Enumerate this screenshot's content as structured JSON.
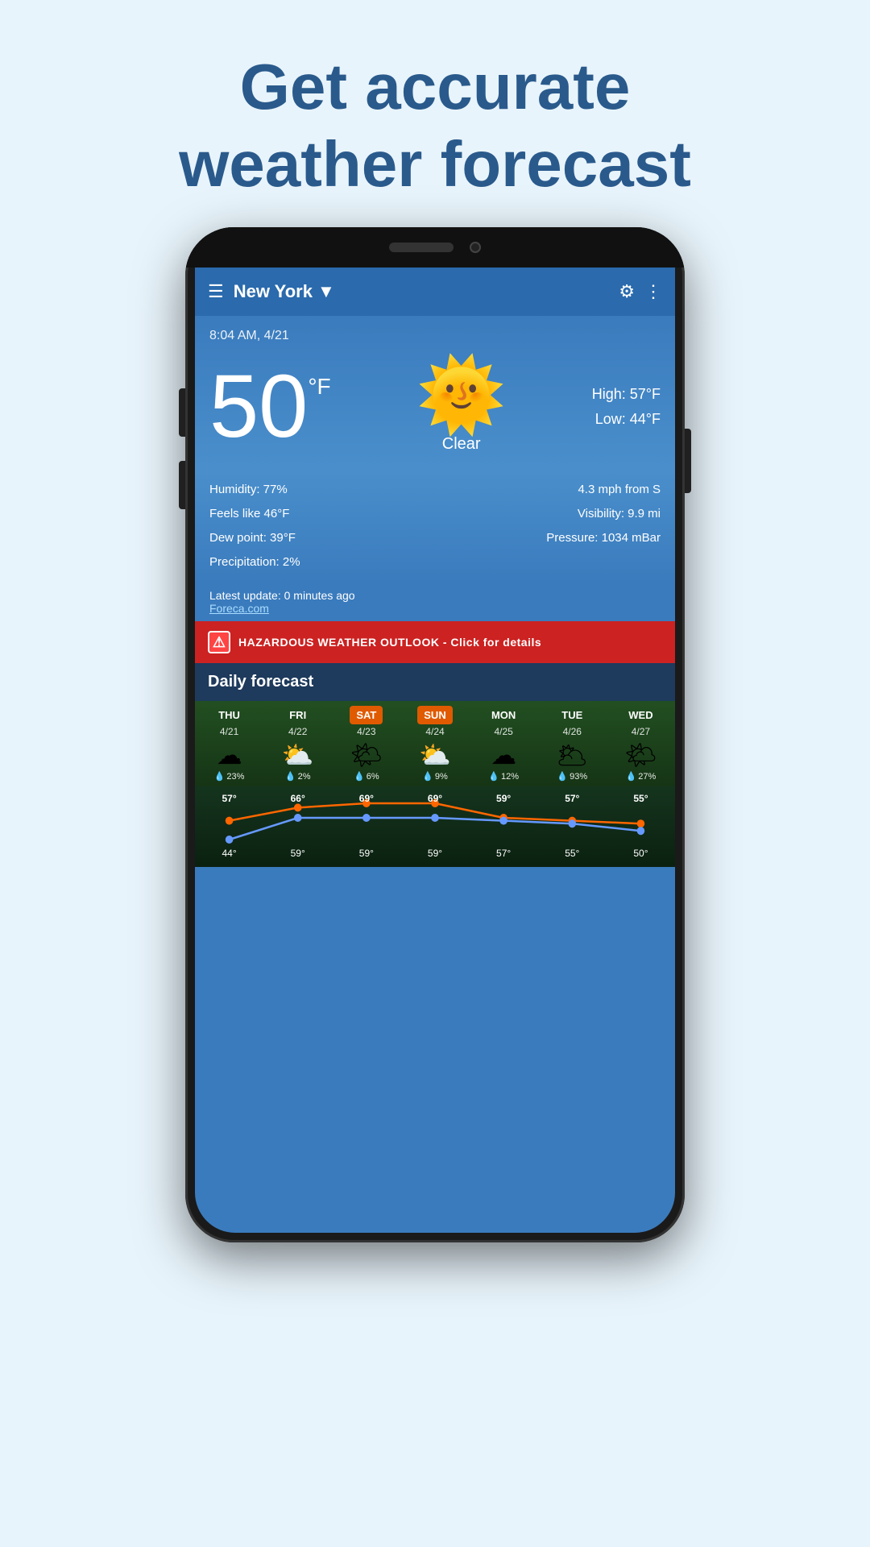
{
  "page": {
    "header_line1": "Get ",
    "header_accent": "accurate",
    "header_line2": "weather forecast"
  },
  "app": {
    "menu_icon": "☰",
    "city": "New York",
    "dropdown_icon": "▼",
    "gear_icon": "⚙",
    "more_icon": "⋮",
    "datetime": "8:04 AM, 4/21",
    "temperature": "50",
    "temp_unit": "°F",
    "condition": "Clear",
    "high_label": "High:",
    "high_value": "57°F",
    "low_label": "Low:",
    "low_value": "44°F",
    "humidity": "Humidity: 77%",
    "feels_like": "Feels like 46°F",
    "dew_point": "Dew point: 39°F",
    "precipitation": "Precipitation: 2%",
    "wind": "4.3 mph from S",
    "visibility": "Visibility: 9.9 mi",
    "pressure": "Pressure: 1034 mBar",
    "update_text": "Latest update: 0 minutes ago",
    "source_link": "Foreca.com",
    "alert_text": "HAZARDOUS WEATHER OUTLOOK - Click for details",
    "daily_forecast_label": "Daily forecast"
  },
  "forecast": {
    "days": [
      {
        "day": "THU",
        "date": "4/21",
        "icon": "☁",
        "precip": "23%",
        "active": false
      },
      {
        "day": "FRI",
        "date": "4/22",
        "icon": "⛅",
        "precip": "2%",
        "active": false
      },
      {
        "day": "SAT",
        "date": "4/23",
        "icon": "🌤",
        "precip": "6%",
        "active": true
      },
      {
        "day": "SUN",
        "date": "4/24",
        "icon": "⛅",
        "precip": "9%",
        "active": true
      },
      {
        "day": "MON",
        "date": "4/25",
        "icon": "☁",
        "precip": "12%",
        "active": false
      },
      {
        "day": "TUE",
        "date": "4/26",
        "icon": "🌥",
        "precip": "93%",
        "active": false
      },
      {
        "day": "WED",
        "date": "4/27",
        "icon": "🌤",
        "precip": "27%",
        "active": false
      }
    ],
    "high_temps": [
      57,
      66,
      69,
      69,
      59,
      57,
      55
    ],
    "low_temps": [
      44,
      59,
      59,
      59,
      57,
      55,
      50
    ]
  },
  "colors": {
    "accent": "#e05a00",
    "sky_blue": "#3a7bbd",
    "dark_blue": "#1a4a7a",
    "alert_red": "#cc2222"
  }
}
